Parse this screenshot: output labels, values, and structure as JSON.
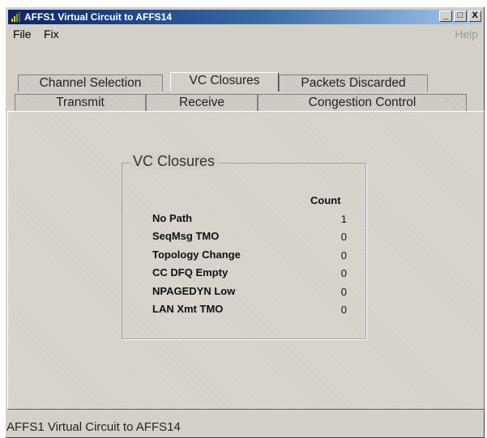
{
  "window": {
    "title": "AFFS1 Virtual Circuit to AFFS14",
    "controls": {
      "minimize": "_",
      "maximize": "□",
      "close": "X"
    }
  },
  "menu": {
    "file": "File",
    "fix": "Fix",
    "help": "Help"
  },
  "tabs": {
    "row1": [
      "Channel Selection",
      "VC Closures",
      "Packets Discarded"
    ],
    "row2": [
      "Transmit",
      "Receive",
      "Congestion Control"
    ],
    "active": "VC Closures"
  },
  "group": {
    "title": "VC Closures",
    "column_header": "Count",
    "rows": [
      {
        "label": "No Path",
        "count": "1"
      },
      {
        "label": "SeqMsg TMO",
        "count": "0"
      },
      {
        "label": "Topology Change",
        "count": "0"
      },
      {
        "label": "CC DFQ Empty",
        "count": "0"
      },
      {
        "label": "NPAGEDYN Low",
        "count": "0"
      },
      {
        "label": "LAN Xmt TMO",
        "count": "0"
      }
    ]
  },
  "status": "AFFS1 Virtual Circuit to AFFS14",
  "colors": {
    "titlebar_start": "#0a246a",
    "titlebar_end": "#a6caf0",
    "face": "#d4d0c8"
  }
}
